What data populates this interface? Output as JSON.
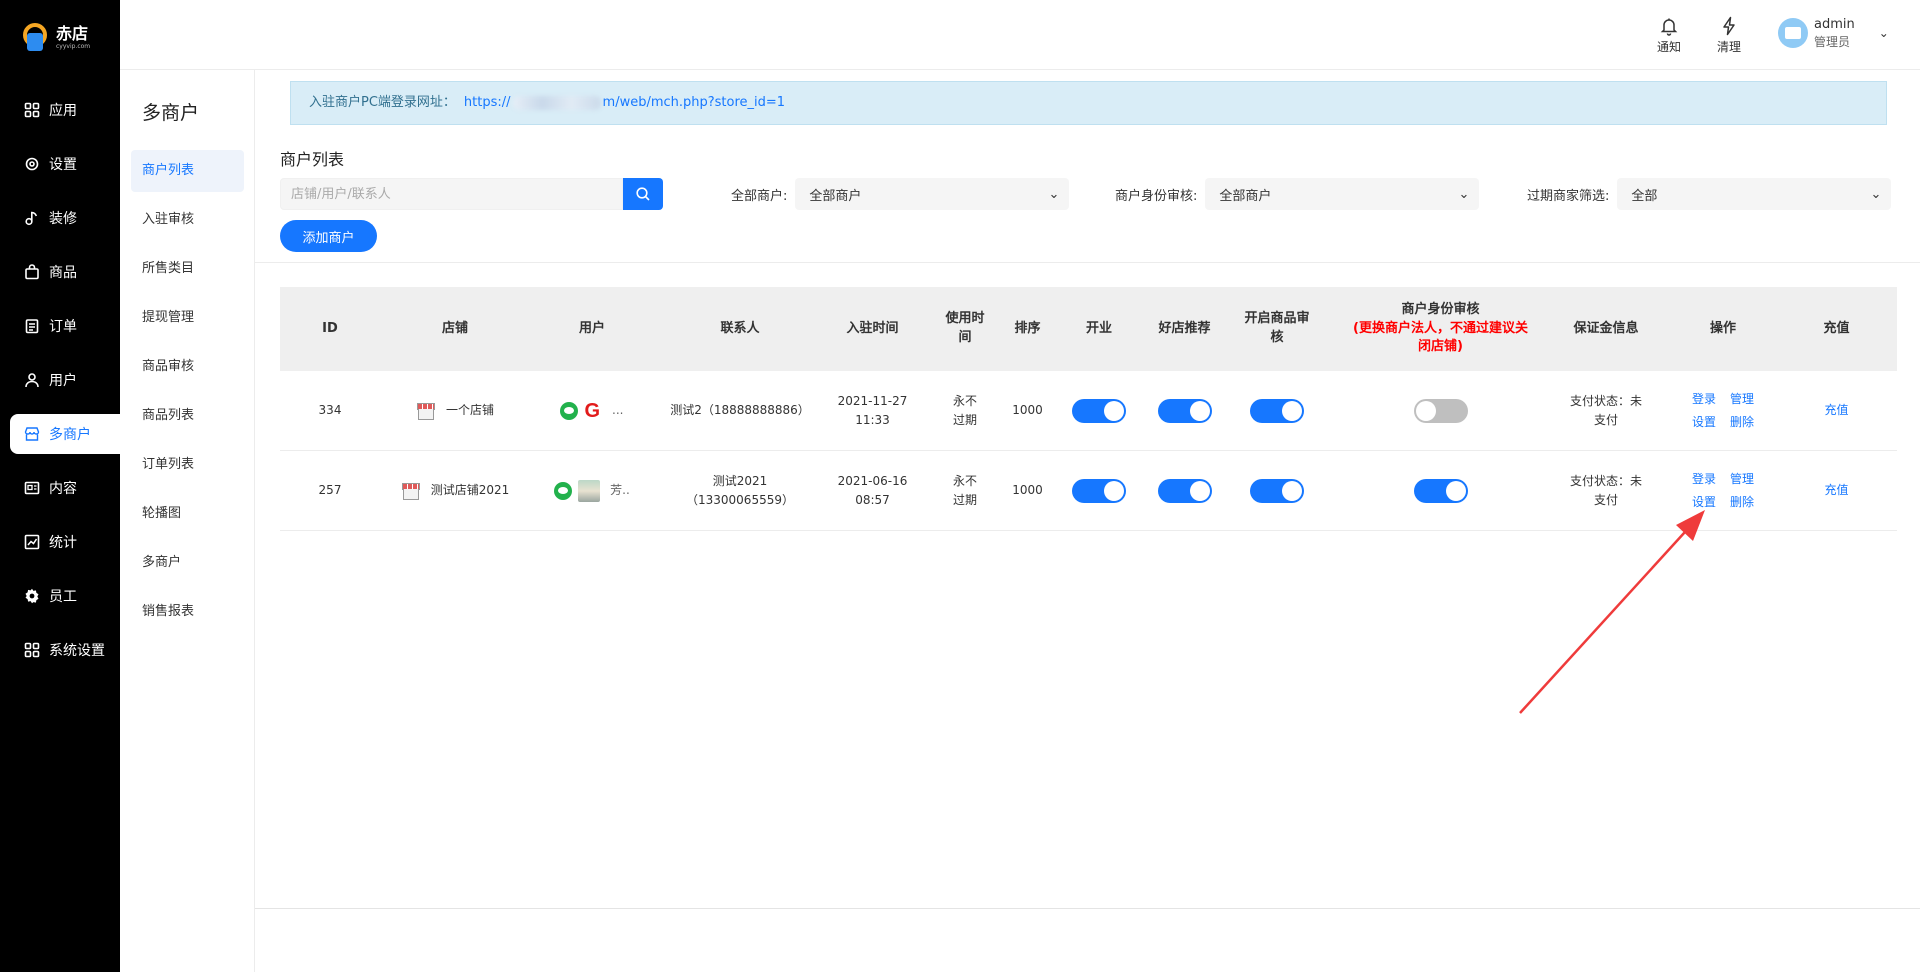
{
  "brand": {
    "name": "赤店",
    "sub": "cyyvip.com"
  },
  "sidebar": {
    "items": [
      {
        "label": "应用",
        "icon": "grid-icon"
      },
      {
        "label": "设置",
        "icon": "gear-icon"
      },
      {
        "label": "装修",
        "icon": "music-note-icon"
      },
      {
        "label": "商品",
        "icon": "bag-icon"
      },
      {
        "label": "订单",
        "icon": "clipboard-icon"
      },
      {
        "label": "用户",
        "icon": "user-icon"
      },
      {
        "label": "多商户",
        "icon": "store-icon",
        "active": true
      },
      {
        "label": "内容",
        "icon": "document-icon"
      },
      {
        "label": "统计",
        "icon": "chart-icon"
      },
      {
        "label": "员工",
        "icon": "cog-icon"
      },
      {
        "label": "系统设置",
        "icon": "grid-icon"
      }
    ]
  },
  "submenu": {
    "title": "多商户",
    "items": [
      "商户列表",
      "入驻审核",
      "所售类目",
      "提现管理",
      "商品审核",
      "商品列表",
      "订单列表",
      "轮播图",
      "多商户",
      "销售报表"
    ],
    "active_index": 0
  },
  "header": {
    "notify_label": "通知",
    "clean_label": "清理",
    "user_name": "admin",
    "user_role": "管理员"
  },
  "notice": {
    "label": "入驻商户PC端登录网址：",
    "url_start": "https://",
    "url_end": "m/web/mch.php?store_id=1"
  },
  "list": {
    "title": "商户列表",
    "search_placeholder": "店铺/用户/联系人",
    "add_button": "添加商户"
  },
  "filters": [
    {
      "label": "全部商户:",
      "value": "全部商户"
    },
    {
      "label": "商户身份审核:",
      "value": "全部商户"
    },
    {
      "label": "过期商家筛选:",
      "value": "全部"
    }
  ],
  "table": {
    "columns": [
      "ID",
      "店铺",
      "用户",
      "联系人",
      "入驻时间",
      "使用时间",
      "排序",
      "开业",
      "好店推荐",
      "开启商品审核",
      "商户身份审核",
      "保证金信息",
      "操作",
      "充值"
    ],
    "identity_warning": "(更换商户法人，不通过建议关闭店铺)",
    "rows": [
      {
        "id": "334",
        "store": "一个店铺",
        "user_avatar": "G",
        "user_name": "...",
        "contact": "测试2（18888888886）",
        "joined_date": "2021-11-27",
        "joined_time": "11:33",
        "use_time": "永不过期",
        "sort": "1000",
        "open": true,
        "recommend": true,
        "goods_audit": true,
        "identity_audit": false,
        "deposit": "支付状态：未支付",
        "ops": [
          "登录",
          "管理",
          "设置",
          "删除"
        ],
        "recharge": "充值"
      },
      {
        "id": "257",
        "store": "测试店铺2021",
        "user_avatar": "photo",
        "user_name": "芳..",
        "contact": "测试2021（13300065559）",
        "joined_date": "2021-06-16",
        "joined_time": "08:57",
        "use_time": "永不过期",
        "sort": "1000",
        "open": true,
        "recommend": true,
        "goods_audit": true,
        "identity_audit": true,
        "deposit": "支付状态：未支付",
        "ops": [
          "登录",
          "管理",
          "设置",
          "删除"
        ],
        "recharge": "充值"
      }
    ]
  },
  "colors": {
    "accent": "#1677ff",
    "warning": "#ff0000",
    "sidebar_bg": "#000000",
    "annotation": "#ef3b3b"
  }
}
